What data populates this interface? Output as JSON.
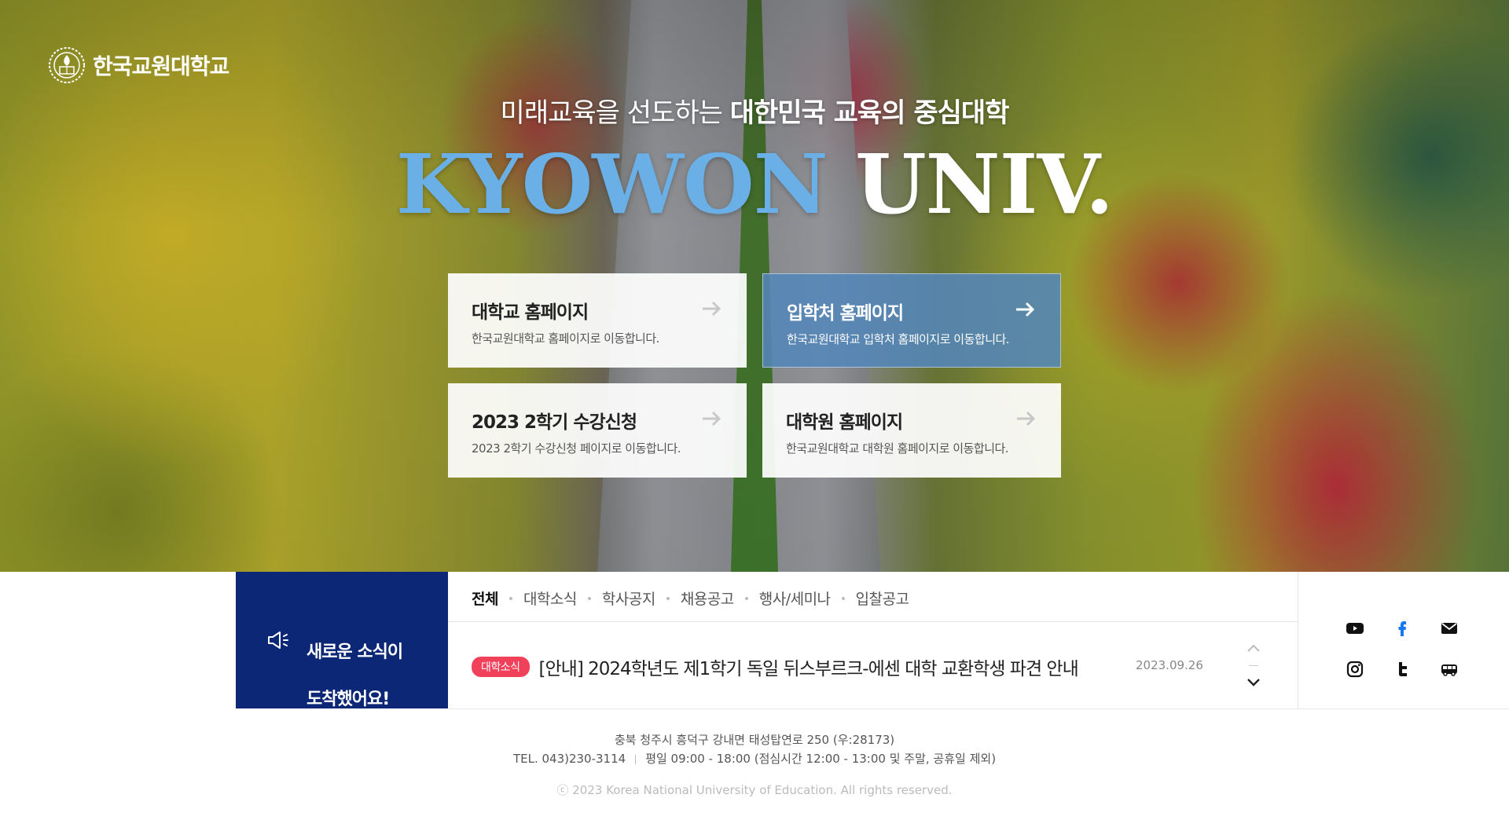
{
  "logo": {
    "text": "한국교원대학교"
  },
  "hero": {
    "tagline_light": "미래교육을 선도하는 ",
    "tagline_bold": "대한민국 교육의 중심대학",
    "brand_part1": "KYOWON",
    "brand_part2": " UNIV."
  },
  "quick_links": [
    {
      "title": "대학교 홈페이지",
      "desc": "한국교원대학교 홈페이지로 이동합니다."
    },
    {
      "title": "입학처 홈페이지",
      "desc": "한국교원대학교 입학처 홈페이지로 이동합니다."
    },
    {
      "title": "2023 2학기 수강신청",
      "desc": "2023 2학기 수강신청 페이지로 이동합니다."
    },
    {
      "title": "대학원 홈페이지",
      "desc": "한국교원대학교 대학원 홈페이지로 이동합니다."
    }
  ],
  "news": {
    "message_line1": "새로운 소식이",
    "message_line2": "도착했어요!",
    "tabs": [
      "전체",
      "대학소식",
      "학사공지",
      "채용공고",
      "행사/세미나",
      "입찰공고"
    ],
    "active_tab": "전체",
    "item": {
      "category": "대학소식",
      "title": "[안내] 2024학년도 제1학기 독일 뒤스부르크-에센 대학 교환학생 파견 안내",
      "date": "2023.09.26"
    }
  },
  "social_icons": [
    "youtube-icon",
    "facebook-icon",
    "mail-icon",
    "instagram-icon",
    "twitter-icon",
    "bus-icon"
  ],
  "colors": {
    "brand_blue": "#6ab0e6",
    "news_navy": "#0b2776",
    "badge_red": "#f0405a",
    "active_card": "#5486b8",
    "facebook": "#1877f2"
  },
  "footer": {
    "address": "충북 청주시 흥덕구 강내면 태성탑연로 250 (우:28173)",
    "tel": "TEL. 043)230-3114",
    "hours": "평일 09:00 - 18:00 (점심시간 12:00 - 13:00 및 주말, 공휴일 제외)",
    "copyright": "ⓒ 2023 Korea National University of Education. All rights reserved."
  }
}
